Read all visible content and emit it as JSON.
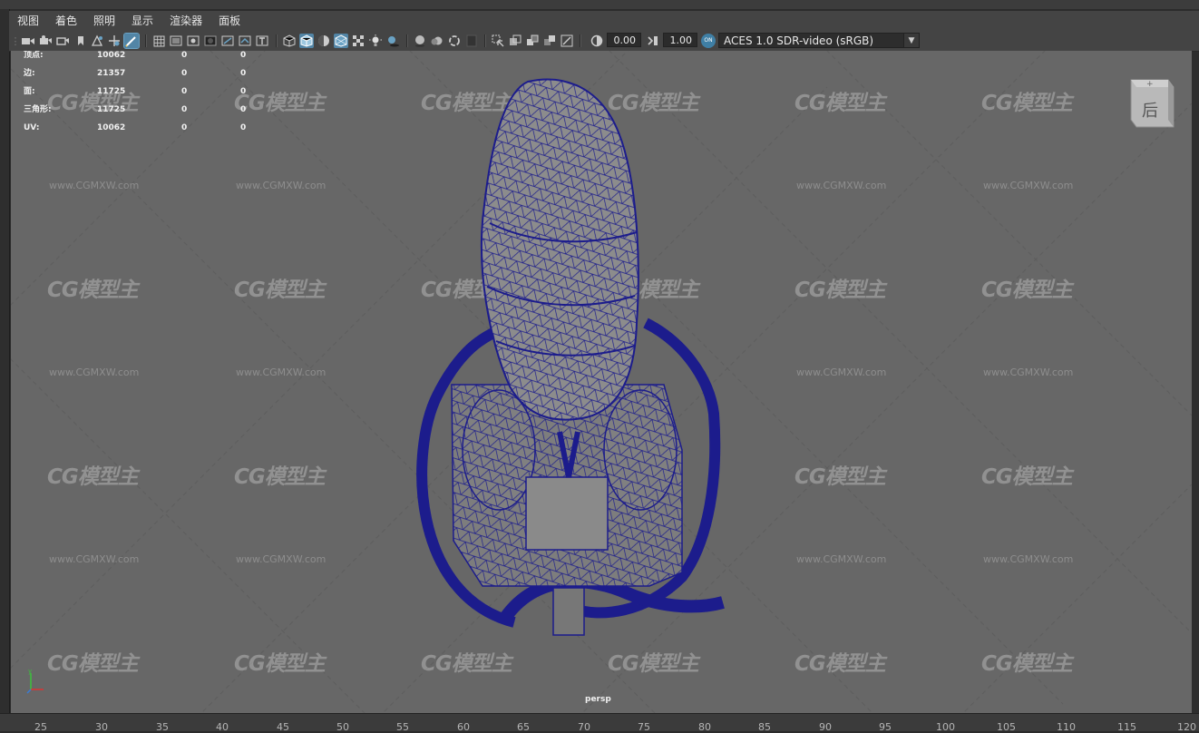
{
  "menu": [
    "视图",
    "着色",
    "照明",
    "显示",
    "渲染器",
    "面板"
  ],
  "toolbar": {
    "exposure_value": "0.00",
    "gamma_value": "1.00",
    "color_space_icon": "color-management-icon",
    "color_space": "ACES 1.0 SDR-video (sRGB)"
  },
  "hud": {
    "rows": [
      {
        "label": "顶点:",
        "c1": "10062",
        "c2": "0",
        "c3": "0"
      },
      {
        "label": "边:",
        "c1": "21357",
        "c2": "0",
        "c3": "0"
      },
      {
        "label": "面:",
        "c1": "11725",
        "c2": "0",
        "c3": "0"
      },
      {
        "label": "三角形:",
        "c1": "11725",
        "c2": "0",
        "c3": "0"
      },
      {
        "label": "UV:",
        "c1": "10062",
        "c2": "0",
        "c3": "0"
      }
    ]
  },
  "viewcube": {
    "face_label": "后"
  },
  "camera_label": "persp",
  "axis_indicator": {
    "label": "y"
  },
  "watermark": {
    "logo": "CG模型主",
    "url": "www.CGMXW.com"
  },
  "ruler": [
    "25",
    "30",
    "35",
    "40",
    "45",
    "50",
    "55",
    "60",
    "65",
    "70",
    "75",
    "80",
    "85",
    "90",
    "95",
    "100",
    "105",
    "110",
    "115",
    "120"
  ],
  "colors": {
    "viewport_bg": "#676767",
    "wireframe": "#1c1c8c",
    "accent": "#5285a6"
  }
}
